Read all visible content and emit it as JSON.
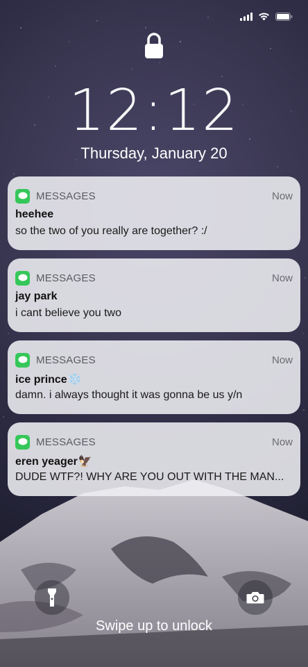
{
  "status": {
    "signal_icon": "signal-bars-icon",
    "wifi_icon": "wifi-icon",
    "battery_icon": "battery-icon"
  },
  "lockscreen": {
    "time": "12:12",
    "date": "Thursday, January 20",
    "swipe_hint": "Swipe up to unlock",
    "flashlight_icon": "flashlight-icon",
    "camera_icon": "camera-icon"
  },
  "notifications": [
    {
      "app": "MESSAGES",
      "time": "Now",
      "sender": "heehee",
      "sender_emoji": "",
      "body": "so the two of you really are together? :/"
    },
    {
      "app": "MESSAGES",
      "time": "Now",
      "sender": "jay park",
      "sender_emoji": "",
      "body": "i cant believe you two"
    },
    {
      "app": "MESSAGES",
      "time": "Now",
      "sender": "ice prince",
      "sender_emoji": "❄️",
      "body": "damn. i always thought it was gonna be us y/n"
    },
    {
      "app": "MESSAGES",
      "time": "Now",
      "sender": "eren yeager",
      "sender_emoji": "🦅",
      "body": "DUDE WTF?! WHY ARE YOU OUT WITH THE MAN..."
    }
  ],
  "colors": {
    "messages_green": "#35c759",
    "card_bg": "#eeeef2"
  }
}
